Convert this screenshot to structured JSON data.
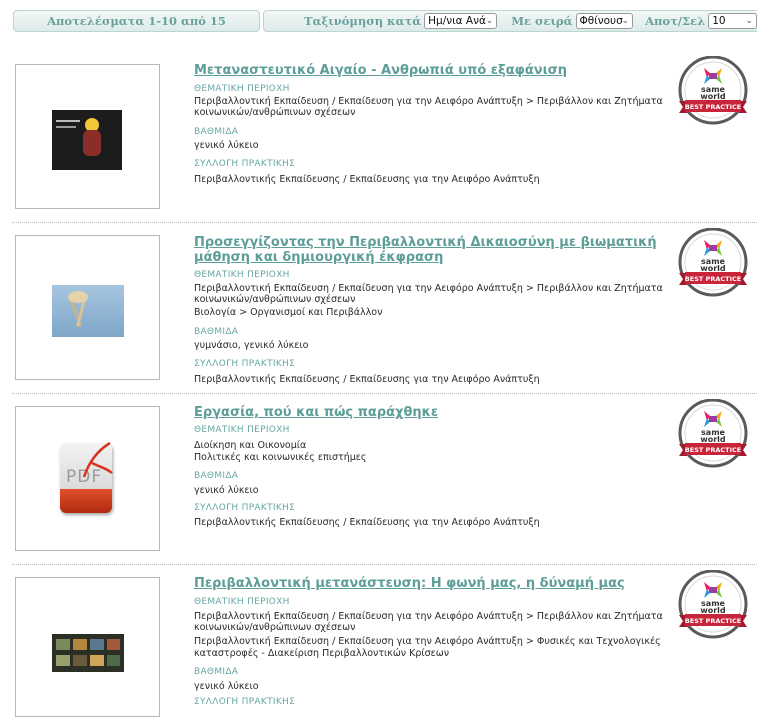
{
  "topbar": {
    "results_text": "Αποτελέσματα 1-10 από 15",
    "sort_label": "Ταξινόμηση κατά",
    "sort_value": "Ημ/νια Ανά",
    "order_label": "Με σειρά",
    "order_value": "Φθίνουσ",
    "per_page_label": "Αποτ/Σελ",
    "per_page_value": "10"
  },
  "badge": {
    "line1": "same",
    "line2": "world",
    "ribbon": "BEST PRACTICE"
  },
  "thumb_labels": {
    "pdf": "PDF"
  },
  "results": [
    {
      "title": "Μεταναστευτικό Αιγαίο - Ανθρωπιά υπό εξαφάνιση",
      "thematic_label": "ΘΕΜΑΤΙΚΗ ΠΕΡΙΟΧΗ",
      "thematic_lines": [
        "Περιβαλλοντική Εκπαίδευση / Εκπαίδευση για την Αειφόρο Ανάπτυξη > Περιβάλλον και Ζητήματα",
        "κοινωνικών/ανθρώπινων σχέσεων"
      ],
      "level_label": "ΒΑΘΜΙΔΑ",
      "level_value": "γενικό λύκειο",
      "collection_label": "ΣΥΛΛΟΓΗ ΠΡΑΚΤΙΚΗΣ",
      "collection_value": "Περιβαλλοντικής Εκπαίδευσης / Εκπαίδευσης για την Αειφόρο Ανάπτυξη"
    },
    {
      "title_lines": [
        "Προσεγγίζοντας την Περιβαλλοντική Δικαιοσύνη με βιωματική",
        "μάθηση και δημιουργική έκφραση"
      ],
      "thematic_label": "ΘΕΜΑΤΙΚΗ ΠΕΡΙΟΧΗ",
      "thematic_lines": [
        "Περιβαλλοντική Εκπαίδευση / Εκπαίδευση για την Αειφόρο Ανάπτυξη > Περιβάλλον και Ζητήματα",
        "κοινωνικών/ανθρώπινων σχέσεων",
        "Βιολογία > Οργανισμοί και Περιβάλλον"
      ],
      "level_label": "ΒΑΘΜΙΔΑ",
      "level_value": "γυμνάσιο, γενικό λύκειο",
      "collection_label": "ΣΥΛΛΟΓΗ ΠΡΑΚΤΙΚΗΣ",
      "collection_value": "Περιβαλλοντικής Εκπαίδευσης / Εκπαίδευσης για την Αειφόρο Ανάπτυξη"
    },
    {
      "title": "Εργασία, πού και πώς παράχθηκε",
      "thematic_label": "ΘΕΜΑΤΙΚΗ ΠΕΡΙΟΧΗ",
      "thematic_lines": [
        "Διοίκηση και Οικονομία",
        "Πολιτικές και κοινωνικές επιστήμες"
      ],
      "level_label": "ΒΑΘΜΙΔΑ",
      "level_value": "γενικό λύκειο",
      "collection_label": "ΣΥΛΛΟΓΗ ΠΡΑΚΤΙΚΗΣ",
      "collection_value": "Περιβαλλοντικής Εκπαίδευσης / Εκπαίδευσης για την Αειφόρο Ανάπτυξη"
    },
    {
      "title": "Περιβαλλοντική μετανάστευση: Η φωνή μας, η δύναμή μας",
      "thematic_label": "ΘΕΜΑΤΙΚΗ ΠΕΡΙΟΧΗ",
      "thematic_lines": [
        "Περιβαλλοντική Εκπαίδευση / Εκπαίδευση για την Αειφόρο Ανάπτυξη > Περιβάλλον και Ζητήματα",
        "κοινωνικών/ανθρώπινων σχέσεων",
        "Περιβαλλοντική Εκπαίδευση / Εκπαίδευση για την Αειφόρο Ανάπτυξη > Φυσικές και Τεχνολογικές",
        "καταστροφές - Διακείριση Περιβαλλοντικών Κρίσεων"
      ],
      "level_label": "ΒΑΘΜΙΔΑ",
      "level_value": "γενικό λύκειο",
      "collection_label": "ΣΥΛΛΟΓΗ ΠΡΑΚΤΙΚΗΣ"
    }
  ],
  "colors": {
    "accent": "#5e9e99",
    "label": "#66a8a2",
    "ribbon": "#c8243a",
    "badge_ring": "#555555"
  }
}
